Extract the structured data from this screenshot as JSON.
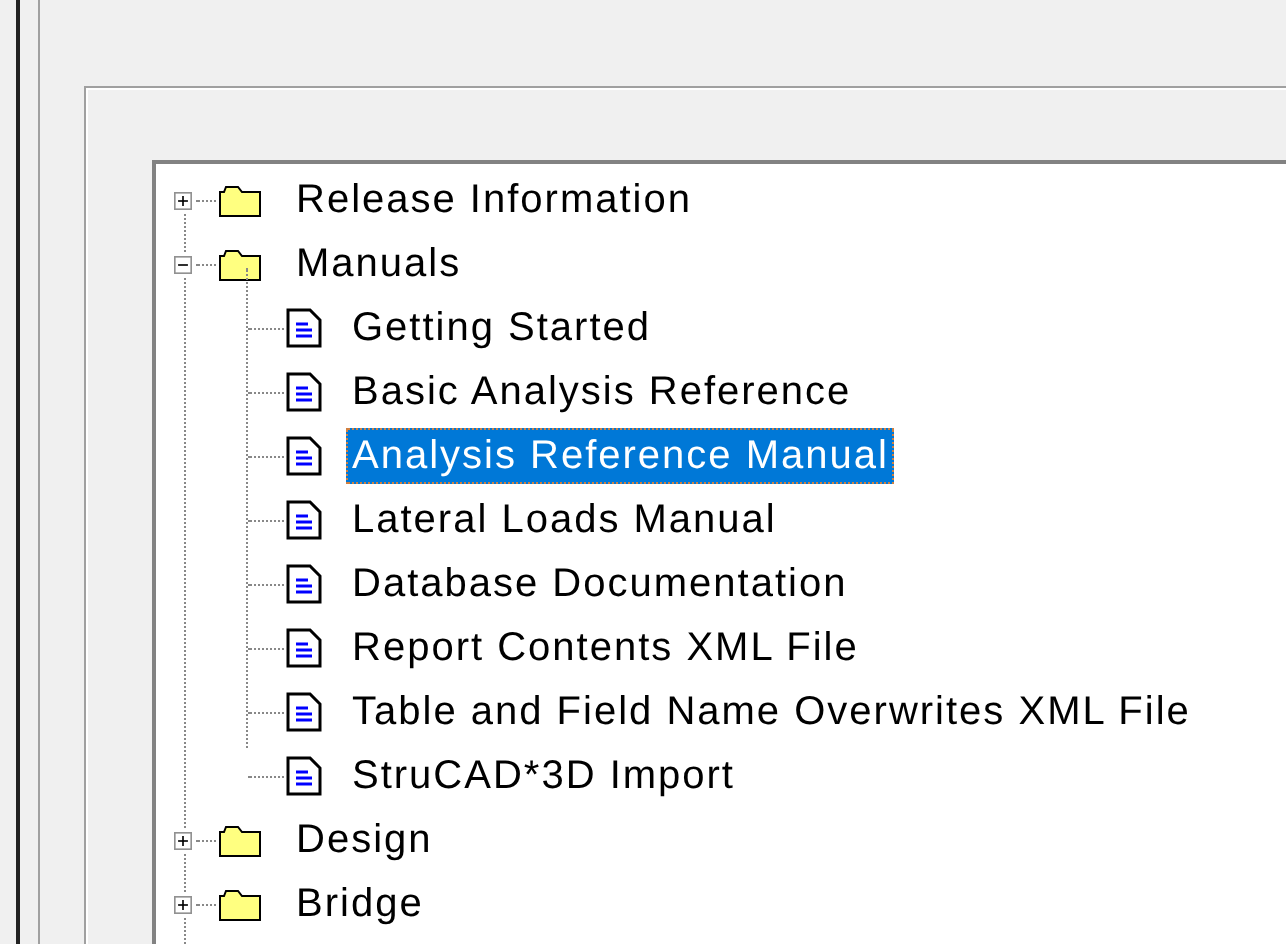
{
  "tree": [
    {
      "kind": "folder",
      "label": "Release Information",
      "expanded": false,
      "selected": false
    },
    {
      "kind": "folder",
      "label": "Manuals",
      "expanded": true,
      "selected": false,
      "children": [
        {
          "kind": "document",
          "label": "Getting Started",
          "selected": false
        },
        {
          "kind": "document",
          "label": "Basic Analysis Reference",
          "selected": false
        },
        {
          "kind": "document",
          "label": "Analysis Reference Manual",
          "selected": true
        },
        {
          "kind": "document",
          "label": "Lateral Loads Manual",
          "selected": false
        },
        {
          "kind": "document",
          "label": "Database Documentation",
          "selected": false
        },
        {
          "kind": "document",
          "label": "Report Contents XML File",
          "selected": false
        },
        {
          "kind": "document",
          "label": "Table and Field Name Overwrites XML File",
          "selected": false
        },
        {
          "kind": "document",
          "label": "StruCAD*3D Import",
          "selected": false
        }
      ]
    },
    {
      "kind": "folder",
      "label": "Design",
      "expanded": false,
      "selected": false
    },
    {
      "kind": "folder",
      "label": "Bridge",
      "expanded": false,
      "selected": false
    }
  ]
}
